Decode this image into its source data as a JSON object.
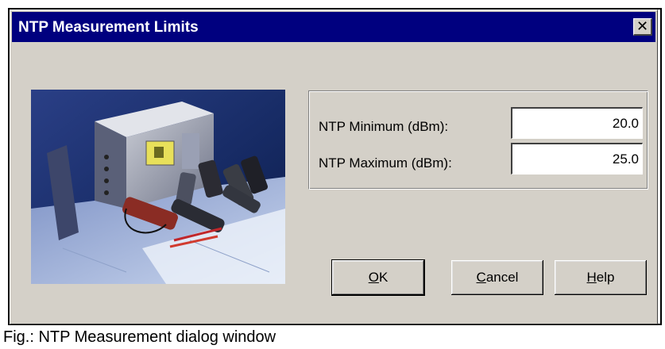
{
  "dialog": {
    "title": "NTP Measurement Limits",
    "close_glyph": "✕"
  },
  "fields": {
    "min_label": "NTP Minimum (dBm):",
    "min_value": "20.0",
    "max_label": "NTP Maximum (dBm):",
    "max_value": "25.0"
  },
  "buttons": {
    "ok": {
      "mnemonic": "O",
      "rest": "K"
    },
    "cancel": {
      "mnemonic": "C",
      "rest": "ancel"
    },
    "help": {
      "mnemonic": "H",
      "rest": "elp"
    }
  },
  "caption": "Fig.: NTP Measurement dialog window",
  "colors": {
    "titlebar": "#00007f",
    "dialog_face": "#d4d0c8",
    "photo_bg": "#1c2f6a"
  },
  "icons": {
    "close": "close-icon"
  }
}
